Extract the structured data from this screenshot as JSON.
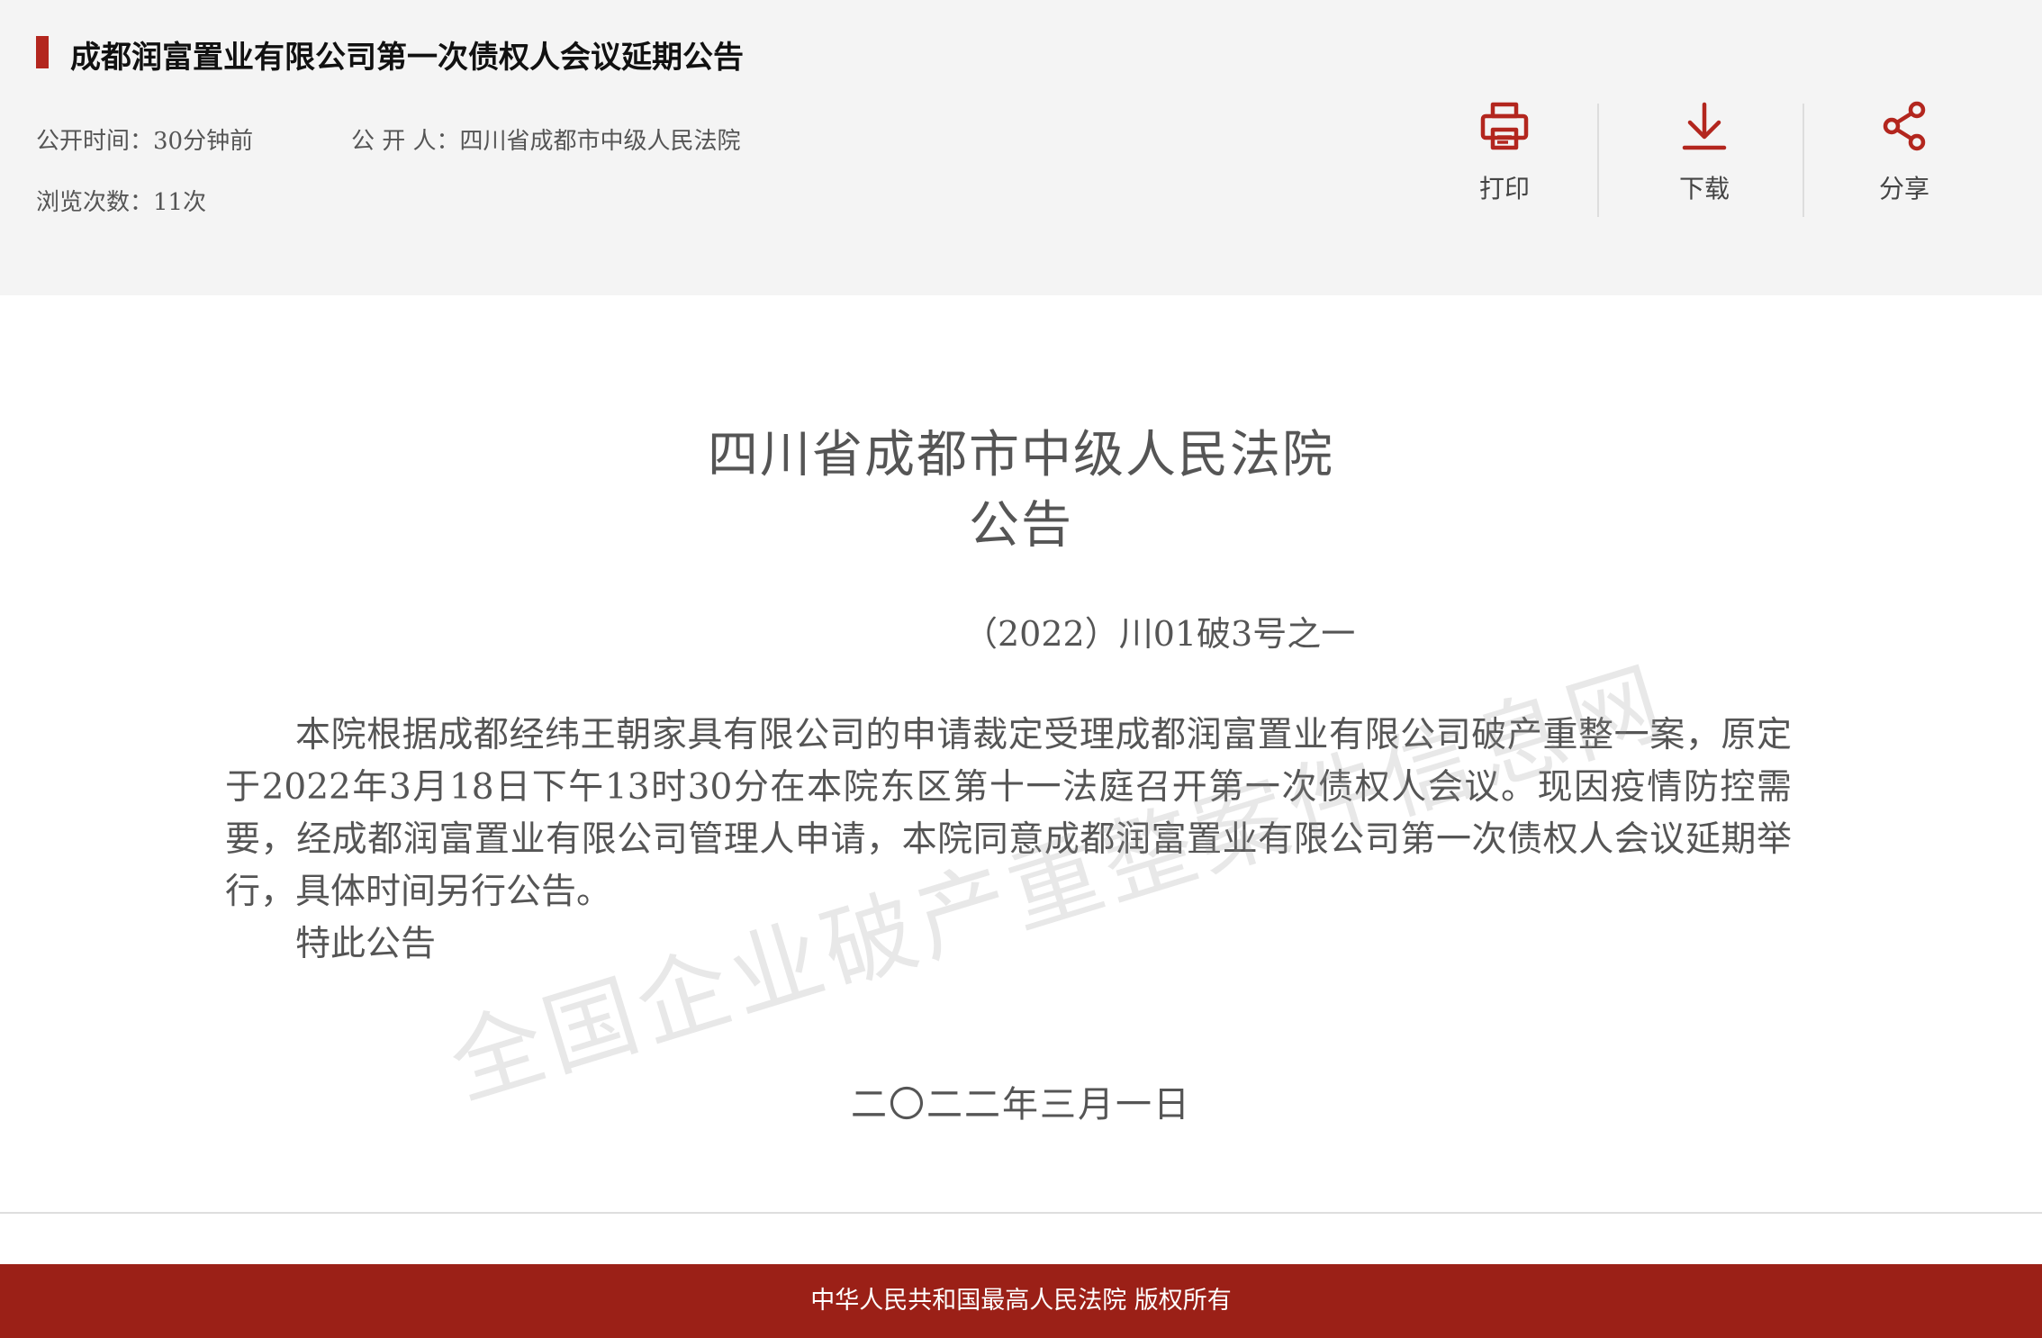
{
  "header": {
    "title": "成都润富置业有限公司第一次债权人会议延期公告",
    "publish_time_label": "公开时间：",
    "publish_time_value": "30分钟前",
    "publisher_label": "公 开 人：",
    "publisher_value": "四川省成都市中级人民法院",
    "views_label": "浏览次数：",
    "views_value": "11次"
  },
  "actions": {
    "print_label": "打印",
    "download_label": "下载",
    "share_label": "分享"
  },
  "icons": {
    "print": "printer-icon",
    "download": "download-icon",
    "share": "share-icon"
  },
  "colors": {
    "accent": "#b3261e",
    "footer_bg": "#9b2017"
  },
  "document": {
    "court_name": "四川省成都市中级人民法院",
    "notice_word": "公告",
    "case_number": "（2022）川01破3号之一",
    "paragraphs": [
      "本院根据成都经纬王朝家具有限公司的申请裁定受理成都润富置业有限公司破产重整一案，原定于2022年3月18日下午13时30分在本院东区第十一法庭召开第一次债权人会议。现因疫情防控需要，经成都润富置业有限公司管理人申请，本院同意成都润富置业有限公司第一次债权人会议延期举行，具体时间另行公告。",
      "特此公告"
    ],
    "date": "二〇二二年三月一日",
    "watermark": "全国企业破产重整案件信息网"
  },
  "footer": {
    "copyright": "中华人民共和国最高人民法院 版权所有"
  }
}
